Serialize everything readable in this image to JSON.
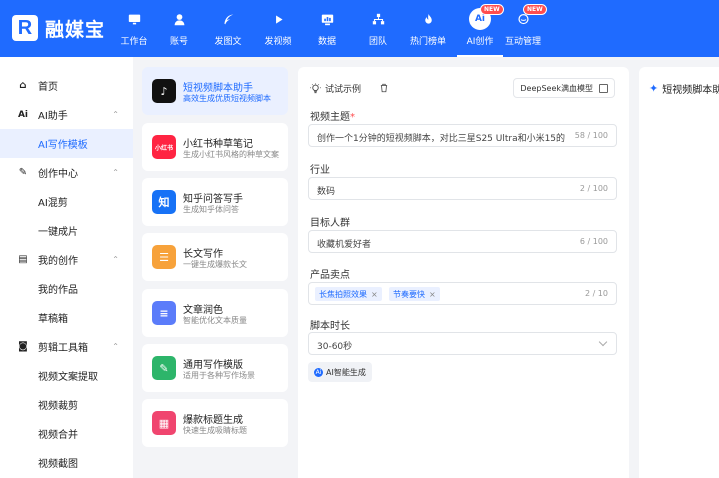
{
  "brand": {
    "logo_letter": "R",
    "name": "融媒宝"
  },
  "nav": [
    {
      "label": "工作台",
      "icon": "monitor-icon"
    },
    {
      "label": "账号",
      "icon": "user-icon"
    },
    {
      "label": "发图文",
      "icon": "feather-icon"
    },
    {
      "label": "发视频",
      "icon": "play-icon"
    },
    {
      "label": "数据",
      "icon": "chart-icon"
    },
    {
      "label": "团队",
      "icon": "team-icon"
    },
    {
      "label": "热门榜单",
      "icon": "fire-icon"
    },
    {
      "label": "AI创作",
      "icon": "ai-icon",
      "badge": "NEW",
      "active": true,
      "glyph": "Ai"
    },
    {
      "label": "互动管理",
      "icon": "chat-icon",
      "badge": "NEW"
    }
  ],
  "sidebar": {
    "items": [
      {
        "label": "首页",
        "icon_glyph": "⌂"
      },
      {
        "label": "AI助手",
        "icon_glyph": "Ai",
        "arrow": "⌃"
      },
      {
        "label": "AI写作模板",
        "active": true
      },
      {
        "label": "创作中心",
        "icon_glyph": "✎",
        "arrow": "⌃"
      },
      {
        "label": "AI混剪"
      },
      {
        "label": "一键成片"
      },
      {
        "label": "我的创作",
        "icon_glyph": "▤",
        "arrow": "⌃"
      },
      {
        "label": "我的作品"
      },
      {
        "label": "草稿箱"
      },
      {
        "label": "剪辑工具箱",
        "icon_glyph": "◙",
        "arrow": "⌃"
      },
      {
        "label": "视频文案提取"
      },
      {
        "label": "视频裁剪"
      },
      {
        "label": "视频合并"
      },
      {
        "label": "视频截图"
      }
    ]
  },
  "templates": [
    {
      "title": "短视频脚本助手",
      "desc": "高效生成优质短视频脚本",
      "glyph": "♪",
      "color": "#111111",
      "active": true
    },
    {
      "title": "小红书种草笔记",
      "desc": "生成小红书风格的种草文案",
      "glyph": "小红书",
      "color": "#ff2442"
    },
    {
      "title": "知乎问答写手",
      "desc": "生成知乎体问答",
      "glyph": "知",
      "color": "#1772f6"
    },
    {
      "title": "长文写作",
      "desc": "一键生成爆款长文",
      "glyph": "☰",
      "color": "#f7a23b"
    },
    {
      "title": "文章润色",
      "desc": "智能优化文本质量",
      "glyph": "≡",
      "color": "#5b7cfa"
    },
    {
      "title": "通用写作模版",
      "desc": "适用于各种写作场景",
      "glyph": "✎",
      "color": "#2db56a"
    },
    {
      "title": "爆款标题生成",
      "desc": "快速生成吸睛标题",
      "glyph": "▦",
      "color": "#f0456f"
    }
  ],
  "form": {
    "example_label": "试试示例",
    "model_label": "DeepSeek满血模型",
    "fields": {
      "topic": {
        "label": "视频主题",
        "required_mark": "*",
        "value": "创作一个1分钟的短视频脚本，对比三星S25 Ultra和小米15的",
        "count": "58 / 100"
      },
      "industry": {
        "label": "行业",
        "value": "数码",
        "count": "2 / 100"
      },
      "audience": {
        "label": "目标人群",
        "value": "收藏机爱好者",
        "count": "6 / 100"
      },
      "selling": {
        "label": "产品卖点",
        "tags": [
          "长焦拍照效果",
          "节奏要快"
        ],
        "tag_close": "×",
        "count": "2 / 10"
      },
      "duration": {
        "label": "脚本时长",
        "value": "30-60秒"
      }
    },
    "ai_button": {
      "icon_glyph": "Ai",
      "label": "AI智能生成"
    }
  },
  "preview": {
    "title_icon": "✦",
    "title": "短视频脚本助"
  }
}
